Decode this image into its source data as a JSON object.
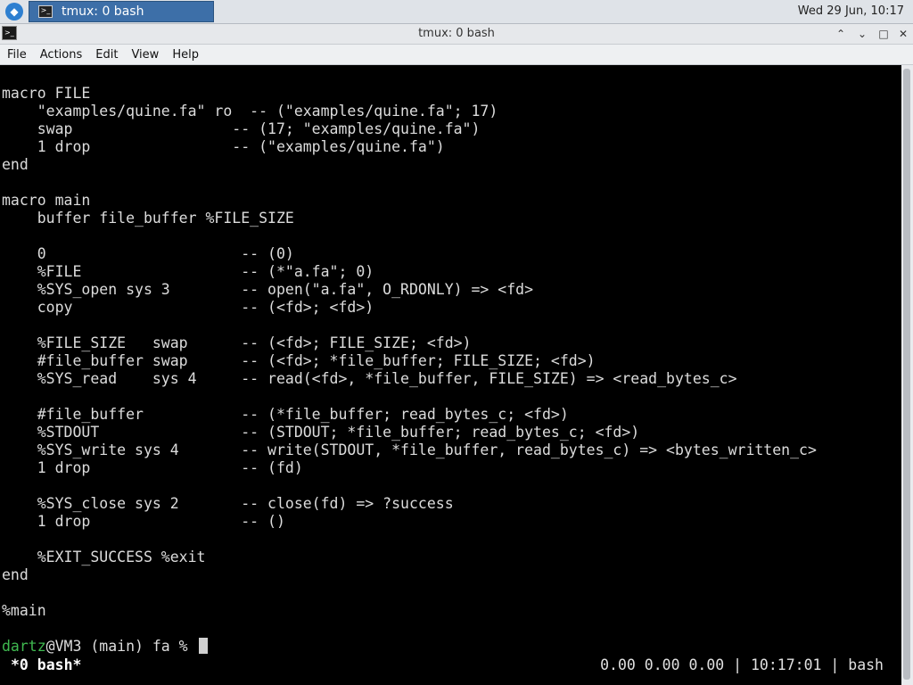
{
  "panel": {
    "taskbar_item_label": "tmux: 0 bash",
    "clock": "Wed 29 Jun, 10:17"
  },
  "window": {
    "title": "tmux: 0 bash",
    "buttons": {
      "minimize": "⌃",
      "restore": "⌄",
      "maximize": "□",
      "close": "✕"
    }
  },
  "menu": [
    "File",
    "Actions",
    "Edit",
    "View",
    "Help"
  ],
  "terminal": {
    "lines": [
      "macro FILE",
      "    \"examples/quine.fa\" ro  -- (\"examples/quine.fa\"; 17)",
      "    swap                  -- (17; \"examples/quine.fa\")",
      "    1 drop                -- (\"examples/quine.fa\")",
      "end",
      "",
      "macro main",
      "    buffer file_buffer %FILE_SIZE",
      "",
      "    0                      -- (0)",
      "    %FILE                  -- (*\"a.fa\"; 0)",
      "    %SYS_open sys 3        -- open(\"a.fa\", O_RDONLY) => <fd>",
      "    copy                   -- (<fd>; <fd>)",
      "",
      "    %FILE_SIZE   swap      -- (<fd>; FILE_SIZE; <fd>)",
      "    #file_buffer swap      -- (<fd>; *file_buffer; FILE_SIZE; <fd>)",
      "    %SYS_read    sys 4     -- read(<fd>, *file_buffer, FILE_SIZE) => <read_bytes_c>",
      "",
      "    #file_buffer           -- (*file_buffer; read_bytes_c; <fd>)",
      "    %STDOUT                -- (STDOUT; *file_buffer; read_bytes_c; <fd>)",
      "    %SYS_write sys 4       -- write(STDOUT, *file_buffer, read_bytes_c) => <bytes_written_c>",
      "    1 drop                 -- (fd)",
      "",
      "    %SYS_close sys 2       -- close(fd) => ?success",
      "    1 drop                 -- ()",
      "",
      "    %EXIT_SUCCESS %exit",
      "end",
      "",
      "%main",
      ""
    ],
    "prompt_user": "dartz",
    "prompt_rest": "@VM3 (main) fa % "
  },
  "tmux_status": {
    "window": "*0 bash*",
    "right": "0.00 0.00 0.00 | 10:17:01 | bash"
  },
  "colors": {
    "terminal_bg": "#000000",
    "prompt_user": "#3fb950",
    "taskbar_active": "#3d6fa8"
  }
}
